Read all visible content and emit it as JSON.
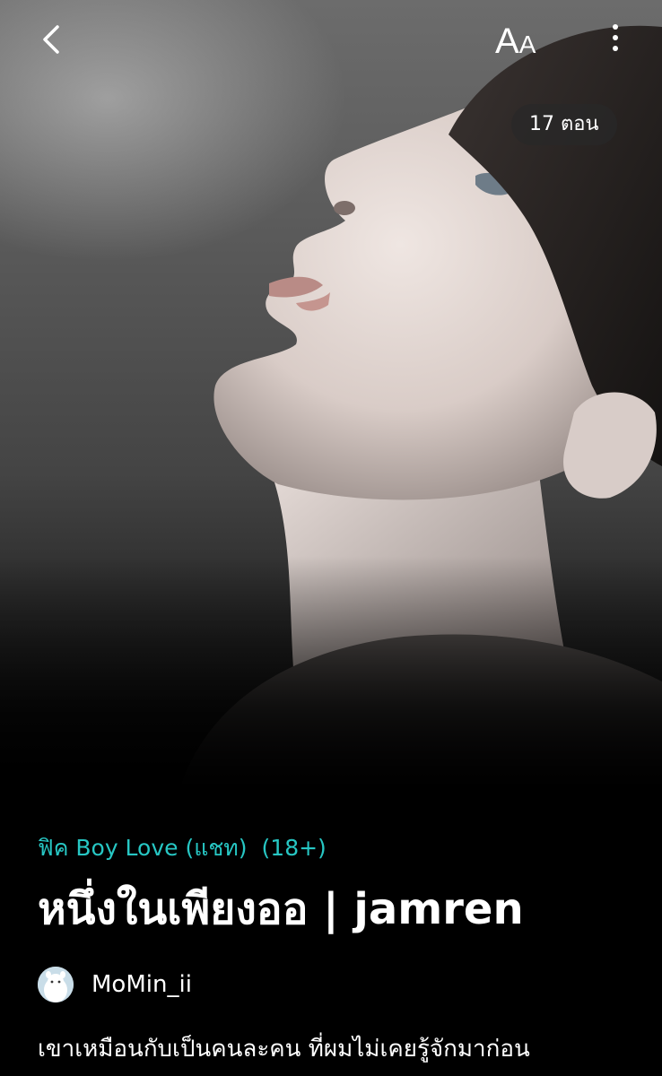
{
  "header": {
    "back_icon": "chevron-left-icon",
    "font_size_label_big": "A",
    "font_size_label_small": "A",
    "more_icon": "vertical-dots-icon"
  },
  "cover": {
    "episode_count": "17 ตอน",
    "image": "portrait of a young man with dark hair looking upward"
  },
  "story": {
    "category": "ฟิค Boy Love (แชท)",
    "rating": "(18+)",
    "title": "หนึ่งในเพียงออ | jamren",
    "author": "MoMin_ii",
    "synopsis": "เขาเหมือนกับเป็นคนละคน ที่ผมไม่เคยรู้จักมาก่อน"
  },
  "colors": {
    "accent": "#27c7c4",
    "background": "#000000",
    "text": "#ffffff"
  }
}
